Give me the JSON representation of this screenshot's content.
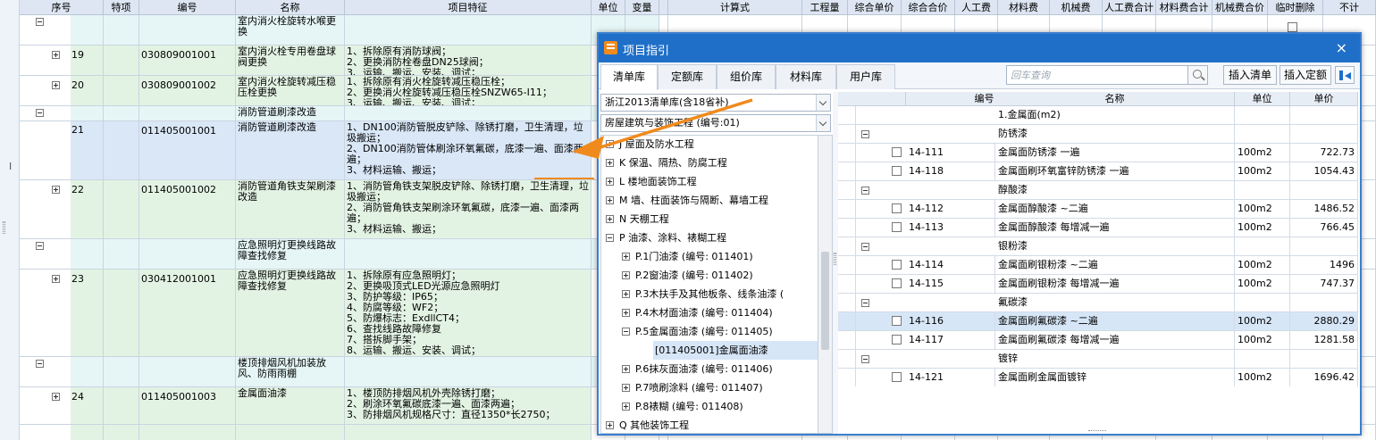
{
  "grid": {
    "headers": [
      "序号",
      "特项",
      "编号",
      "名称",
      "项目特征",
      "单位",
      "变量",
      "计算式",
      "工程量",
      "综合单价",
      "综合合价",
      "人工费",
      "材料费",
      "机械费",
      "人工费合计",
      "材料费合计",
      "机械费合价",
      "临时删除",
      "不计"
    ],
    "rows": [
      {
        "seq": "",
        "code": "",
        "name": "室内消火栓旋转水喉更换",
        "feature": "",
        "toggle": "minus",
        "bg": "cyan"
      },
      {
        "seq": "19",
        "code": "030809001001",
        "name": "室内消火栓专用卷盘球阀更换",
        "feature": "1、拆除原有消防球阀；\n2、更换消防栓卷盘DN25球阀；\n3、运输、搬运、安装、调试；",
        "toggle": "plus",
        "bg": "green"
      },
      {
        "seq": "20",
        "code": "030809001002",
        "name": "室内消火栓旋转减压稳压栓更换",
        "feature": "1、拆除原有消火栓旋转减压稳压栓；\n2、更换消火栓旋转减压稳压栓SNZW65-I11；\n3、运输、搬运、安装、调试；",
        "toggle": "plus",
        "bg": "green"
      },
      {
        "seq": "",
        "code": "",
        "name": "消防管道刷漆改造",
        "feature": "",
        "toggle": "minus",
        "bg": "cyan"
      },
      {
        "seq": "21",
        "code": "011405001001",
        "name": "消防管道刷漆改造",
        "feature": "1、DN100消防管脱皮铲除、除锈打磨，卫生清理，垃圾搬运；\n2、DN100消防管体刷涂环氧氟碳，底漆一遍、面漆两遍；\n3、材料运输、搬运；",
        "toggle": "",
        "bg": "blue"
      },
      {
        "seq": "22",
        "code": "011405001002",
        "name": "消防管道角铁支架刷漆改造",
        "feature": "1、消防管角铁支架脱皮铲除、除锈打磨，卫生清理，垃圾搬运；\n2、消防管角铁支架刷涂环氧氟碳，底漆一遍、面漆两遍；\n3、材料运输、搬运；",
        "toggle": "plus",
        "bg": "green"
      },
      {
        "seq": "",
        "code": "",
        "name": "应急照明灯更换线路故障查找修复",
        "feature": "",
        "toggle": "minus",
        "bg": "cyan"
      },
      {
        "seq": "23",
        "code": "030412001001",
        "name": "应急照明灯更换线路故障查找修复",
        "feature": "1、拆除原有应急照明灯；\n2、更换吸顶式LED光源应急照明灯\n3、防护等级：IP65；\n4、防腐等级：WF2；\n5、防爆标志：ExdllCT4；\n6、查找线路故障修复\n7、搭拆脚手架；\n8、运输、搬运、安装、调试；",
        "toggle": "plus",
        "bg": "green"
      },
      {
        "seq": "",
        "code": "",
        "name": "楼顶排烟风机加装放风、防雨雨棚",
        "feature": "",
        "toggle": "minus",
        "bg": "cyan"
      },
      {
        "seq": "24",
        "code": "011405001003",
        "name": "金属面油漆",
        "feature": "1、楼顶防排烟风机外壳除锈打磨；\n2、刷涂环氧氟碳底漆一遍、面漆两遍；\n3、防排烟风机规格尺寸：直径1350*长2750；",
        "toggle": "plus",
        "bg": "green"
      },
      {
        "seq": "",
        "code": "",
        "name": "",
        "feature": "",
        "toggle": "",
        "bg": "green"
      }
    ]
  },
  "dialog": {
    "title": "项目指引",
    "close": "×",
    "tabs": [
      "清单库",
      "定额库",
      "组价库",
      "材料库",
      "用户库"
    ],
    "search_placeholder": "回车查询",
    "insert_list": "插入清单",
    "insert_quota": "插入定额",
    "library_select": "浙江2013清单库(含18省补)",
    "category_select": "房屋建筑与装饰工程 (编号:01)",
    "tree": [
      {
        "label": "J 屋面及防水工程",
        "level": 0,
        "toggle": "plus"
      },
      {
        "label": "K 保温、隔热、防腐工程",
        "level": 0,
        "toggle": "plus"
      },
      {
        "label": "L 楼地面装饰工程",
        "level": 0,
        "toggle": "plus"
      },
      {
        "label": "M 墙、柱面装饰与隔断、幕墙工程",
        "level": 0,
        "toggle": "plus"
      },
      {
        "label": "N 天棚工程",
        "level": 0,
        "toggle": "plus"
      },
      {
        "label": "P 油漆、涂料、裱糊工程",
        "level": 0,
        "toggle": "minus"
      },
      {
        "label": "P.1门油漆 (编号: 011401)",
        "level": 1,
        "toggle": "plus"
      },
      {
        "label": "P.2窗油漆 (编号: 011402)",
        "level": 1,
        "toggle": "plus"
      },
      {
        "label": "P.3木扶手及其他板条、线条油漆 (",
        "level": 1,
        "toggle": "plus"
      },
      {
        "label": "P.4木材面油漆 (编号: 011404)",
        "level": 1,
        "toggle": "plus"
      },
      {
        "label": "P.5金属面油漆 (编号: 011405)",
        "level": 1,
        "toggle": "minus"
      },
      {
        "label": "[011405001]金属面油漆",
        "level": 2,
        "toggle": "",
        "selected": true
      },
      {
        "label": "P.6抹灰面油漆 (编号: 011406)",
        "level": 1,
        "toggle": "plus"
      },
      {
        "label": "P.7喷刷涂料 (编号: 011407)",
        "level": 1,
        "toggle": "plus"
      },
      {
        "label": "P.8裱糊 (编号: 011408)",
        "level": 1,
        "toggle": "plus"
      },
      {
        "label": "Q 其他装饰工程",
        "level": 0,
        "toggle": "plus"
      }
    ],
    "table": {
      "headers": [
        "编号",
        "名称",
        "单位",
        "单价"
      ],
      "rows": [
        {
          "type": "title",
          "name": "1.金属面(m2)",
          "level": 0
        },
        {
          "type": "group",
          "name": "防锈漆",
          "level": 1
        },
        {
          "type": "item",
          "code": "14-111",
          "name": "金属面防锈漆 一遍",
          "unit": "100m2",
          "price": "722.73"
        },
        {
          "type": "item",
          "code": "14-118",
          "name": "金属面刷环氧富锌防锈漆 一遍",
          "unit": "100m2",
          "price": "1054.43"
        },
        {
          "type": "group",
          "name": "醇酸漆",
          "level": 1
        },
        {
          "type": "item",
          "code": "14-112",
          "name": "金属面醇酸漆 ~二遍",
          "unit": "100m2",
          "price": "1486.52"
        },
        {
          "type": "item",
          "code": "14-113",
          "name": "金属面醇酸漆 每增减一遍",
          "unit": "100m2",
          "price": "766.45"
        },
        {
          "type": "group",
          "name": "银粉漆",
          "level": 1
        },
        {
          "type": "item",
          "code": "14-114",
          "name": "金属面刷银粉漆 ~二遍",
          "unit": "100m2",
          "price": "1496"
        },
        {
          "type": "item",
          "code": "14-115",
          "name": "金属面刷银粉漆 每增减一遍",
          "unit": "100m2",
          "price": "747.37"
        },
        {
          "type": "group",
          "name": "氟碳漆",
          "level": 1
        },
        {
          "type": "item",
          "code": "14-116",
          "name": "金属面刷氟碳漆 ~二遍",
          "unit": "100m2",
          "price": "2880.29",
          "selected": true
        },
        {
          "type": "item",
          "code": "14-117",
          "name": "金属面刷氟碳漆 每增减一遍",
          "unit": "100m2",
          "price": "1281.58"
        },
        {
          "type": "group",
          "name": "镀锌",
          "level": 1
        },
        {
          "type": "item",
          "code": "14-121",
          "name": "金属面刷金属面镀锌",
          "unit": "100m2",
          "price": "1696.42"
        }
      ]
    }
  },
  "colors": {
    "accent": "#1f6fc8",
    "arrow": "#f08a1c",
    "selected": "#d6e6f7"
  }
}
